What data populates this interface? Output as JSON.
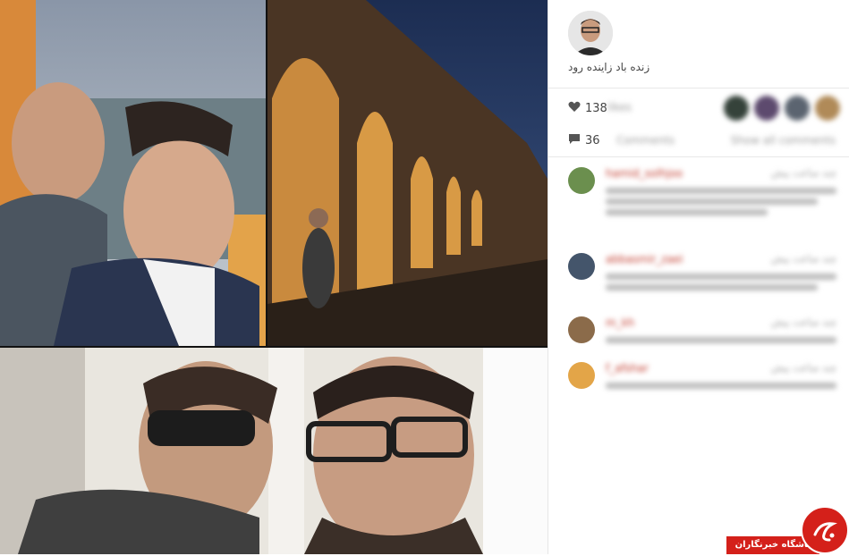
{
  "post": {
    "caption": "زنده باد زاینده رود",
    "likes_count": "138",
    "likes_label": "likes",
    "comments_count": "36",
    "comments_label": "Comments",
    "show_all_label": "Show all comments"
  },
  "comments": [
    {
      "user": "hamid_solhjoo",
      "time": "چند ساعت پیش",
      "avatar_color": "#6b8f4e",
      "lines": 3
    },
    {
      "user": "abbasmir_zaei",
      "time": "چند ساعت پیش",
      "avatar_color": "#44556b",
      "lines": 2
    },
    {
      "user": "m_kh",
      "time": "چند ساعت پیش",
      "avatar_color": "#8b6b4a",
      "lines": 1
    },
    {
      "user": "f_afshar",
      "time": "چند ساعت پیش",
      "avatar_color": "#e3a548",
      "lines": 1
    }
  ],
  "likers": [
    {
      "color": "#35423a"
    },
    {
      "color": "#5d4a6e"
    },
    {
      "color": "#5b6470"
    },
    {
      "color": "#b08a58"
    }
  ],
  "watermark": {
    "text": "باشگاه خبرنگاران"
  },
  "colors": {
    "accent": "#d4201a",
    "username": "#c0392b"
  }
}
